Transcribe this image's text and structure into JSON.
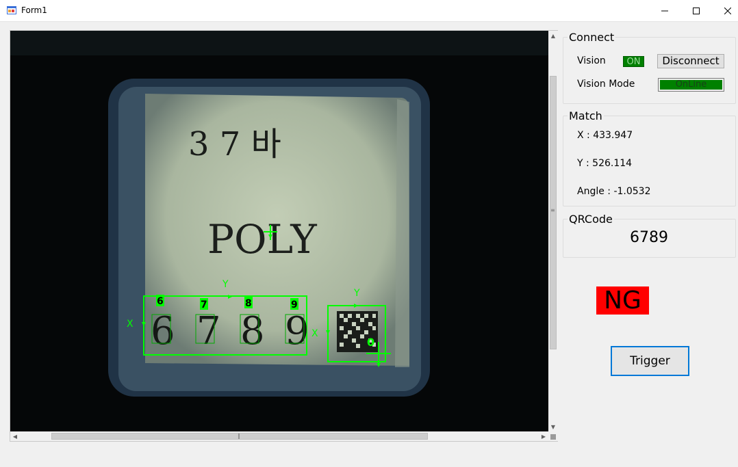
{
  "window": {
    "title": "Form1",
    "minimize_icon": "minimize-icon",
    "maximize_icon": "maximize-icon",
    "close_icon": "close-icon"
  },
  "image": {
    "plate_top": "3  7  바",
    "plate_middle": "POLY",
    "digits": [
      "6",
      "7",
      "8",
      "9"
    ],
    "digit_labels": [
      "6",
      "7",
      "8",
      "9"
    ],
    "axis_x": "X",
    "axis_y": "Y",
    "qr_axis_x": "X",
    "qr_axis_y": "Y",
    "qr_label": "0",
    "overlay_color": "#00ff00"
  },
  "connect": {
    "title": "Connect",
    "vision_label": "Vision",
    "vision_status": "ON",
    "disconnect_label": "Disconnect",
    "mode_label": "Vision Mode",
    "mode_value": "OnLine"
  },
  "match": {
    "title": "Match",
    "x_text": "X : 433.947",
    "y_text": "Y : 526.114",
    "angle_text": "Angle : -1.0532"
  },
  "qrcode": {
    "title": "QRCode",
    "value": "6789"
  },
  "result": {
    "text": "NG",
    "color": "#ff0000"
  },
  "trigger": {
    "label": "Trigger"
  },
  "colors": {
    "status_on": "#008000",
    "accent": "#0078d7"
  }
}
